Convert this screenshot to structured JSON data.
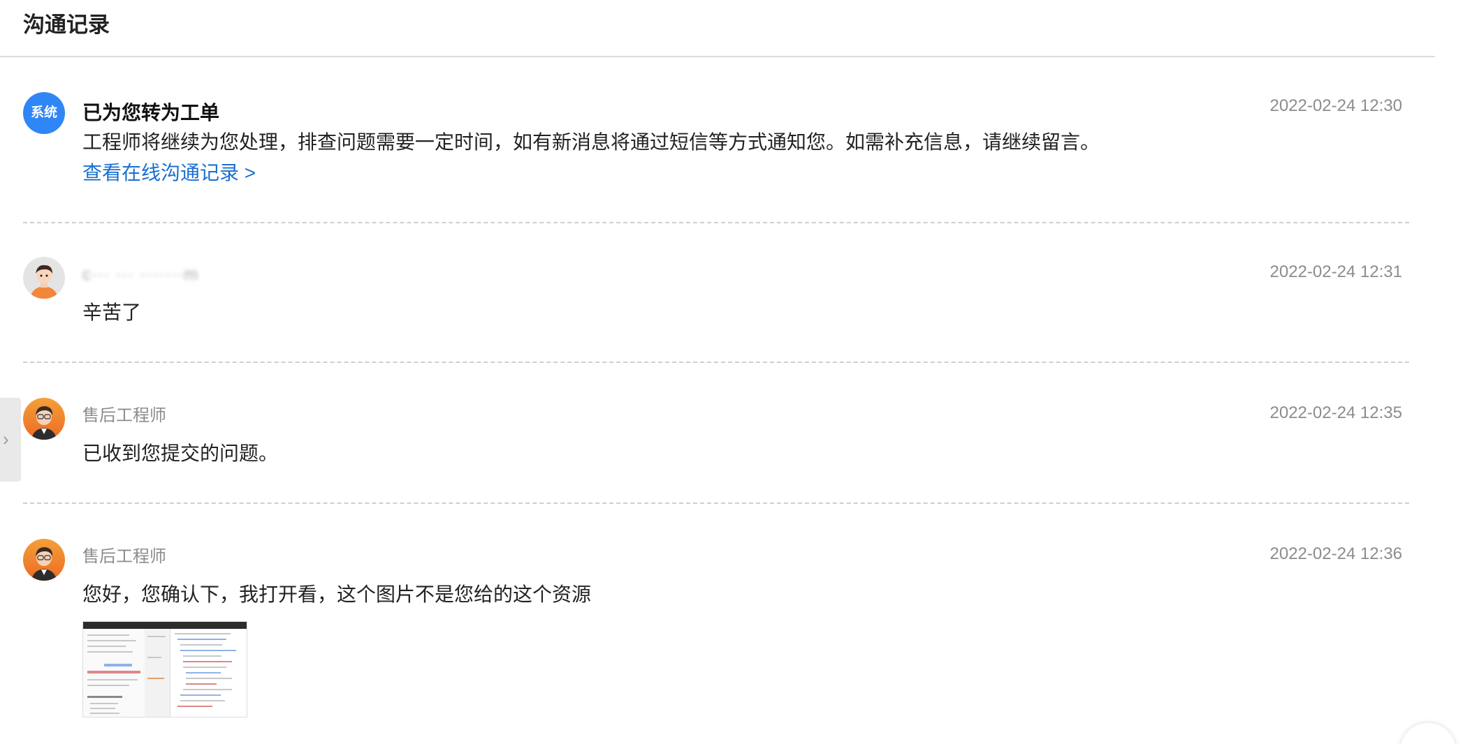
{
  "header": {
    "title": "沟通记录"
  },
  "messages": [
    {
      "avatar_text": "系统",
      "title": "已为您转为工单",
      "time": "2022-02-24 12:30",
      "body": "工程师将继续为您处理，排查问题需要一定时间，如有新消息将通过短信等方式通知您。如需补充信息，请继续留言。",
      "link": "查看在线沟通记录 >"
    },
    {
      "sender": "c··· ··· ·······m",
      "time": "2022-02-24 12:31",
      "body": "辛苦了"
    },
    {
      "sender": "售后工程师",
      "time": "2022-02-24 12:35",
      "body": "已收到您提交的问题。"
    },
    {
      "sender": "售后工程师",
      "time": "2022-02-24 12:36",
      "body": "您好，您确认下，我打开看，这个图片不是您给的这个资源"
    }
  ],
  "side_tab": {
    "icon": "chevron-right-icon",
    "glyph": "›"
  },
  "colors": {
    "accent": "#2f86f6",
    "link": "#1a6fd1",
    "muted": "#8c8c8c"
  }
}
